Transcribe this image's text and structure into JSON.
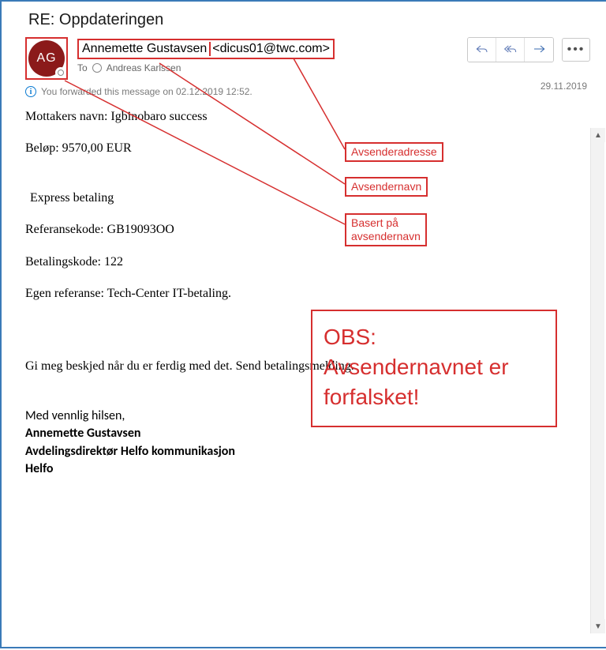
{
  "subject": "RE: Oppdateringen",
  "avatar_initials": "AG",
  "sender": {
    "name": "Annemette Gustavsen",
    "email": "<dicus01@twc.com>"
  },
  "to_label": "To",
  "to_recipient": "Andreas Karlssen",
  "date": "29.11.2019",
  "info_bar": "You forwarded this message on 02.12.2019 12:52.",
  "body": {
    "recipient_line_label": "Mottakers navn: ",
    "recipient_line_value": "Igbinobaro success",
    "amount_label": "Beløp: ",
    "amount_value": "9570,00 EUR",
    "express": "Express betaling",
    "ref_label": "Referansekode: ",
    "ref_value": "GB19093OO",
    "paycode_label": "Betalingskode: ",
    "paycode_value": "122",
    "ownref_label": "Egen referanse: ",
    "ownref_value": "Tech-Center IT-betaling.",
    "closing": "Gi meg beskjed når du er ferdig med det. Send betalingsmelding.",
    "sig_greeting": "Med vennlig hilsen,",
    "sig_name": "Annemette Gustavsen",
    "sig_title": "Avdelingsdirektør Helfo kommunikasjon",
    "sig_org": " Helfo"
  },
  "annotations": {
    "sender_address": "Avsenderadresse",
    "sender_name": "Avsendernavn",
    "based_on": "Basert på\navsendernavn",
    "warning": "OBS:\nAvsendernavnet er forfalsket!"
  },
  "colors": {
    "accent_red": "#d62f2f",
    "avatar_bg": "#8b1a1a",
    "reply_blue": "#4a78c9"
  }
}
